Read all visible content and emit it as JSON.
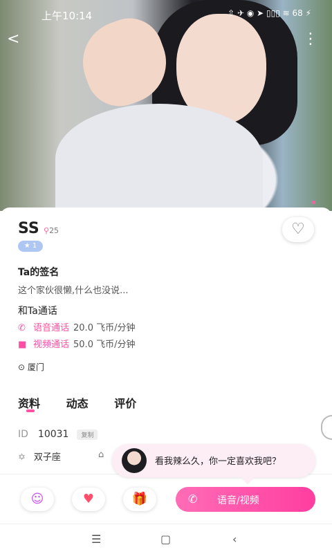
{
  "status_bar": {
    "time": "上午10:14",
    "icons": "⇧ ✈ ◉   ➤ ▯▯▯ ≋ 68 ⚡"
  },
  "top": {
    "back": "<",
    "more": "⋮"
  },
  "profile": {
    "name": "SS",
    "age": "25",
    "level": "★ 1",
    "signature_title": "Ta的签名",
    "signature": "这个家伙很懒,什么也没说...",
    "call_title": "和Ta通话",
    "voice_label": "语音通话",
    "voice_price": "20.0 飞币/分钟",
    "video_label": "视频通话",
    "video_price": "50.0 飞币/分钟",
    "location": "厦门"
  },
  "tabs": [
    "资料",
    "动态",
    "评价"
  ],
  "info": {
    "id_label": "ID",
    "id_value": "10031",
    "copy": "复制",
    "constellation": "双子座"
  },
  "bubble": {
    "text": "看我辣么久，你一定喜欢我吧？"
  },
  "actions": {
    "call_label": "语音/视频"
  },
  "icons": {
    "back": "chevron-left-icon",
    "more": "more-icon",
    "follow": "heart-plus-icon",
    "chat": "chat-icon",
    "like": "heart-icon",
    "gift": "gift-icon",
    "call": "call-icon"
  },
  "colors": {
    "accent": "#ff4fa4"
  }
}
